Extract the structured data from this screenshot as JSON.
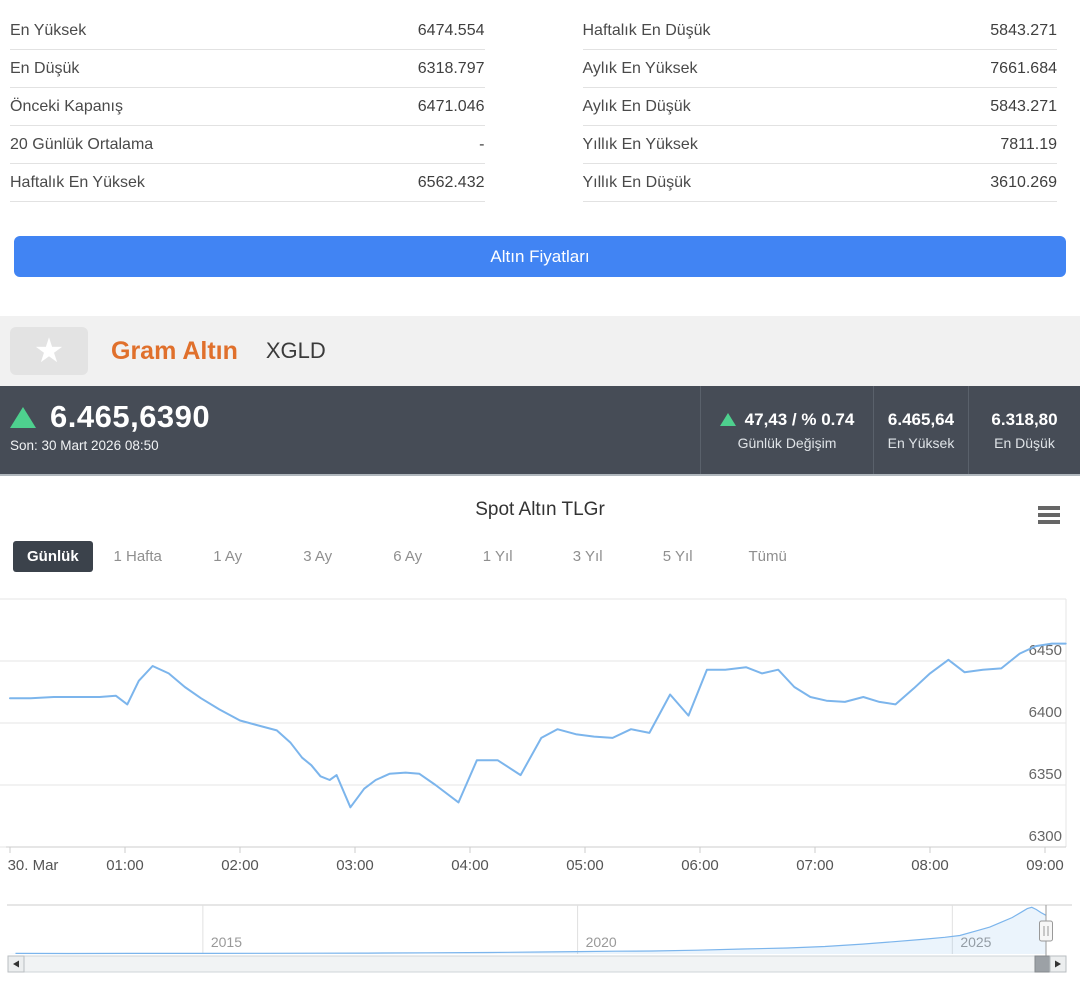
{
  "stats": {
    "left": [
      {
        "label": "En Yüksek",
        "value": "6474.554"
      },
      {
        "label": "En Düşük",
        "value": "6318.797"
      },
      {
        "label": "Önceki Kapanış",
        "value": "6471.046"
      },
      {
        "label": "20 Günlük Ortalama",
        "value": "-"
      },
      {
        "label": "Haftalık En Yüksek",
        "value": "6562.432"
      }
    ],
    "right": [
      {
        "label": "Haftalık En Düşük",
        "value": "5843.271"
      },
      {
        "label": "Aylık En Yüksek",
        "value": "7661.684"
      },
      {
        "label": "Aylık En Düşük",
        "value": "5843.271"
      },
      {
        "label": "Yıllık En Yüksek",
        "value": "7811.19"
      },
      {
        "label": "Yıllık En Düşük",
        "value": "3610.269"
      }
    ]
  },
  "gold_prices_button_label": "Altın Fiyatları",
  "instrument": {
    "name": "Gram Altın",
    "code": "XGLD",
    "star_icon": "star-icon"
  },
  "quote": {
    "price": "6.465,6390",
    "last_label": "Son: 30 Mart 2026 08:50",
    "change": "47,43 / % 0.74",
    "change_label": "Günlük Değişim",
    "high": "6.465,64",
    "high_label": "En Yüksek",
    "low": "6.318,80",
    "low_label": "En Düşük"
  },
  "colors": {
    "accent_blue": "#4184f3",
    "up_green": "#4ed08e",
    "dark_bar": "#464c56",
    "brand_orange": "#e0702c",
    "line_blue": "#7cb5ec",
    "grid": "#e6e6e6",
    "axis": "#cccccc"
  },
  "chart": {
    "title": "Spot Altın TLGr",
    "menu_icon": "hamburger-menu-icon",
    "ranges": [
      "Günlük",
      "1 Hafta",
      "1 Ay",
      "3 Ay",
      "6 Ay",
      "1 Yıl",
      "3 Yıl",
      "5 Yıl",
      "Tümü"
    ],
    "active_range": "Günlük"
  },
  "chart_data": {
    "type": "line",
    "title": "Spot Altın TLGr",
    "xlabel": "",
    "ylabel": "",
    "x_tick_labels": [
      "30. Mar",
      "01:00",
      "02:00",
      "03:00",
      "04:00",
      "05:00",
      "06:00",
      "07:00",
      "08:00",
      "09:00"
    ],
    "y_tick_labels": [
      6450,
      6400,
      6350,
      6300
    ],
    "ylim": [
      6300,
      6500
    ],
    "xlim_hours": [
      0,
      9.18
    ],
    "grid": true,
    "series": [
      {
        "name": "Spot Altın TLGr",
        "points": [
          [
            0.0,
            6420
          ],
          [
            0.18,
            6420
          ],
          [
            0.38,
            6421
          ],
          [
            0.58,
            6421
          ],
          [
            0.78,
            6421
          ],
          [
            0.92,
            6422
          ],
          [
            1.02,
            6415
          ],
          [
            1.12,
            6434
          ],
          [
            1.24,
            6446
          ],
          [
            1.38,
            6440
          ],
          [
            1.52,
            6429
          ],
          [
            1.66,
            6420
          ],
          [
            1.82,
            6411
          ],
          [
            2.0,
            6402
          ],
          [
            2.16,
            6398
          ],
          [
            2.32,
            6394
          ],
          [
            2.44,
            6384
          ],
          [
            2.54,
            6372
          ],
          [
            2.62,
            6366
          ],
          [
            2.7,
            6357
          ],
          [
            2.78,
            6354
          ],
          [
            2.84,
            6358
          ],
          [
            2.96,
            6332
          ],
          [
            3.08,
            6347
          ],
          [
            3.18,
            6354
          ],
          [
            3.3,
            6359
          ],
          [
            3.44,
            6360
          ],
          [
            3.56,
            6359
          ],
          [
            3.7,
            6350
          ],
          [
            3.9,
            6336
          ],
          [
            4.06,
            6370
          ],
          [
            4.24,
            6370
          ],
          [
            4.44,
            6358
          ],
          [
            4.62,
            6388
          ],
          [
            4.76,
            6395
          ],
          [
            4.92,
            6391
          ],
          [
            5.08,
            6389
          ],
          [
            5.24,
            6388
          ],
          [
            5.4,
            6395
          ],
          [
            5.56,
            6392
          ],
          [
            5.74,
            6423
          ],
          [
            5.9,
            6406
          ],
          [
            6.06,
            6443
          ],
          [
            6.22,
            6443
          ],
          [
            6.4,
            6445
          ],
          [
            6.54,
            6440
          ],
          [
            6.68,
            6443
          ],
          [
            6.82,
            6429
          ],
          [
            6.96,
            6421
          ],
          [
            7.1,
            6418
          ],
          [
            7.26,
            6417
          ],
          [
            7.42,
            6421
          ],
          [
            7.56,
            6417
          ],
          [
            7.7,
            6415
          ],
          [
            7.86,
            6428
          ],
          [
            8.0,
            6440
          ],
          [
            8.16,
            6451
          ],
          [
            8.3,
            6441
          ],
          [
            8.46,
            6443
          ],
          [
            8.62,
            6444
          ],
          [
            8.78,
            6456
          ],
          [
            8.92,
            6462
          ],
          [
            9.06,
            6464
          ],
          [
            9.18,
            6464
          ]
        ]
      }
    ],
    "navigator": {
      "year_tick_labels": [
        2015,
        2020,
        2025
      ],
      "ylim": [
        0,
        8200
      ],
      "xlim_years": [
        2012.4,
        2026.25
      ],
      "points": [
        [
          2012.5,
          95
        ],
        [
          2013.2,
          90
        ],
        [
          2014,
          96
        ],
        [
          2015,
          105
        ],
        [
          2015.8,
          112
        ],
        [
          2016.5,
          130
        ],
        [
          2017.2,
          150
        ],
        [
          2018,
          205
        ],
        [
          2018.8,
          250
        ],
        [
          2019.5,
          330
        ],
        [
          2020,
          400
        ],
        [
          2020.5,
          465
        ],
        [
          2021,
          505
        ],
        [
          2021.6,
          640
        ],
        [
          2022.2,
          830
        ],
        [
          2022.8,
          1000
        ],
        [
          2023.3,
          1250
        ],
        [
          2023.8,
          1650
        ],
        [
          2024.2,
          2050
        ],
        [
          2024.6,
          2450
        ],
        [
          2024.9,
          2800
        ],
        [
          2025.1,
          3100
        ],
        [
          2025.3,
          3800
        ],
        [
          2025.5,
          4500
        ],
        [
          2025.65,
          5300
        ],
        [
          2025.8,
          6100
        ],
        [
          2025.92,
          7000
        ],
        [
          2026.0,
          7600
        ],
        [
          2026.06,
          7810
        ],
        [
          2026.12,
          7450
        ],
        [
          2026.18,
          6950
        ],
        [
          2026.25,
          6470
        ]
      ]
    }
  }
}
